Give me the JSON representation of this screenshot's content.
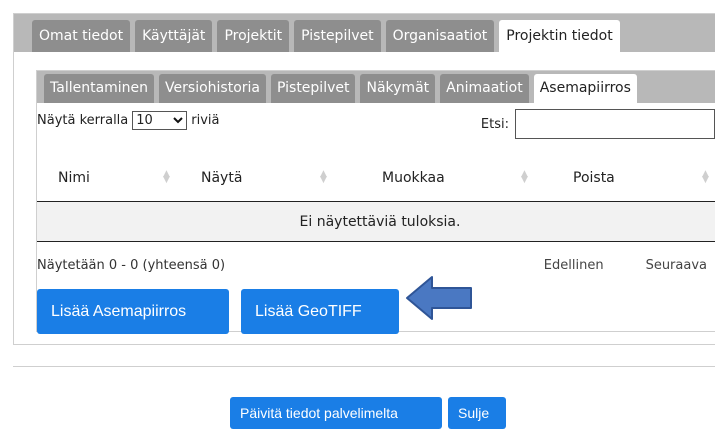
{
  "outer_tabs": [
    {
      "label": "Omat tiedot"
    },
    {
      "label": "Käyttäjät"
    },
    {
      "label": "Projektit"
    },
    {
      "label": "Pistepilvet"
    },
    {
      "label": "Organisaatiot"
    },
    {
      "label": "Projektin tiedot"
    }
  ],
  "inner_tabs": [
    {
      "label": "Tallentaminen"
    },
    {
      "label": "Versiohistoria"
    },
    {
      "label": "Pistepilvet"
    },
    {
      "label": "Näkymät"
    },
    {
      "label": "Animaatiot"
    },
    {
      "label": "Asemapiirros"
    }
  ],
  "table": {
    "length_prefix": "Näytä kerralla",
    "length_value": "10",
    "length_suffix": "riviä",
    "search_label": "Etsi:",
    "search_value": "",
    "columns": [
      {
        "label": "Nimi"
      },
      {
        "label": "Näytä"
      },
      {
        "label": "Muokkaa"
      },
      {
        "label": "Poista"
      }
    ],
    "empty_text": "Ei näytettäviä tuloksia.",
    "info_text": "Näytetään 0 - 0 (yhteensä 0)",
    "prev_label": "Edellinen",
    "next_label": "Seuraava"
  },
  "buttons": {
    "add_site_plan": "Lisää Asemapiirros",
    "add_geotiff": "Lisää GeoTIFF",
    "refresh": "Päivitä tiedot palvelimelta",
    "close": "Sulje"
  },
  "colors": {
    "accent": "#1a7ee6",
    "tab_inactive": "#8e8e8e",
    "tabbar_bg": "#b8b8b8",
    "arrow": "#4a78c2"
  },
  "icons": {
    "pointer": "arrow-left-icon",
    "sort": "sort-icon",
    "dropdown": "chevron-down-icon"
  }
}
